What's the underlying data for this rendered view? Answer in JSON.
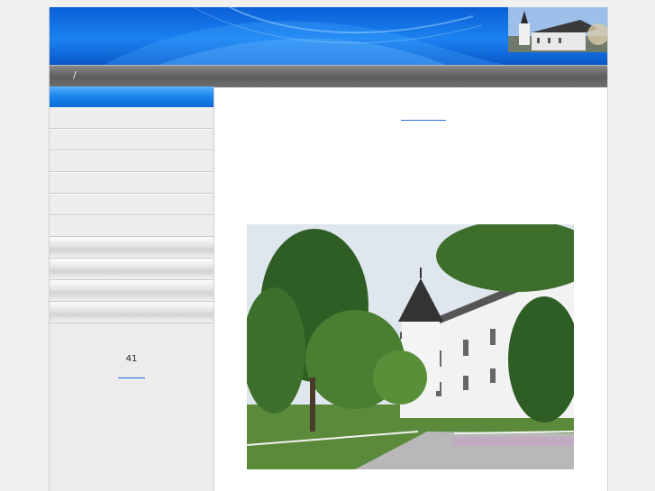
{
  "header": {
    "banner_icon": "swirl-banner",
    "thumbnail_icon": "church-thumbnail"
  },
  "navbar": {
    "separator": "/"
  },
  "sidebar": {
    "active_item": "",
    "items": [
      "",
      "",
      "",
      "",
      "",
      ""
    ],
    "gray_items": [
      "",
      "",
      "",
      ""
    ],
    "counter": "41"
  },
  "main": {
    "photo_icon": "church-photo"
  },
  "colors": {
    "banner_blue": "#1a82f0",
    "active_blue": "#1a86ee",
    "link_blue": "#2a6ee0",
    "navbar_gray": "#6e6e6e"
  }
}
